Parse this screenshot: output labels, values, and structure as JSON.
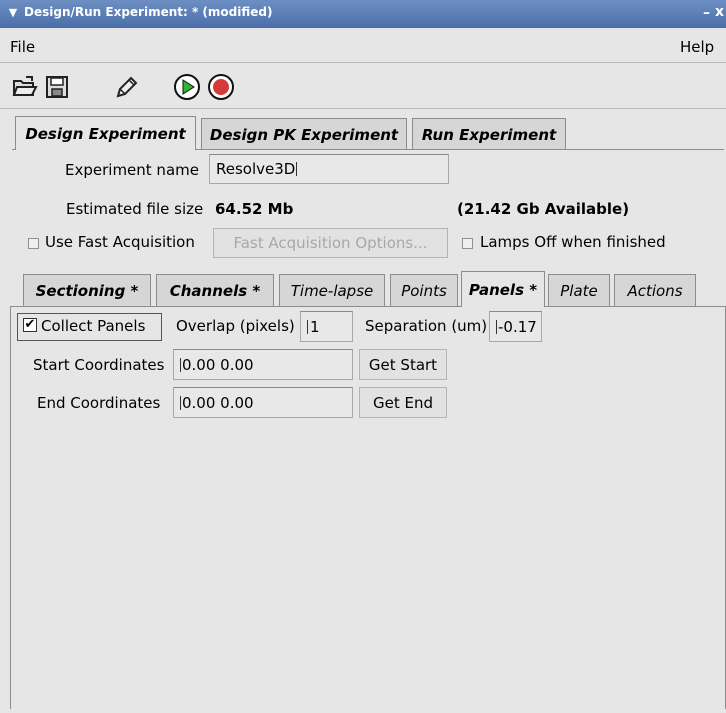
{
  "window": {
    "title": "Design/Run Experiment: * (modified)",
    "menu_icon": "chevron-down-icon",
    "minimize": "–",
    "close": "x"
  },
  "menubar": {
    "file": "File",
    "help": "Help"
  },
  "toolbar": {
    "icons": [
      "open-folder-icon",
      "save-icon",
      "edit-pencil-icon",
      "play-icon",
      "stop-icon"
    ],
    "play_color": "#2eb82e",
    "stop_color": "#d43a3a"
  },
  "main_tabs": [
    "Design Experiment",
    "Design PK Experiment",
    "Run Experiment"
  ],
  "experiment": {
    "name_label": "Experiment name",
    "name_value": "Resolve3D",
    "file_size_label": "Estimated file size",
    "file_size_value": "64.52 Mb",
    "available": "(21.42 Gb Available)",
    "fast_acq_label": "Use Fast Acquisition",
    "fast_acq_options": "Fast Acquisition Options...",
    "lamps_off_label": "Lamps Off when finished"
  },
  "sub_tabs": {
    "sectioning": "Sectioning *",
    "channels": "Channels *",
    "timelapse": "Time-lapse",
    "points": "Points",
    "panels": "Panels *",
    "plate": "Plate",
    "actions": "Actions"
  },
  "panels": {
    "collect_label": "Collect Panels",
    "collect_checked": "✔",
    "overlap_label": "Overlap (pixels)",
    "overlap_value": "1",
    "separation_label": "Separation (um)",
    "separation_value": "-0.17",
    "start_label": "Start Coordinates",
    "start_value": "0.00 0.00",
    "get_start": "Get Start",
    "end_label": "End Coordinates",
    "end_value": "0.00 0.00",
    "get_end": "Get End"
  }
}
